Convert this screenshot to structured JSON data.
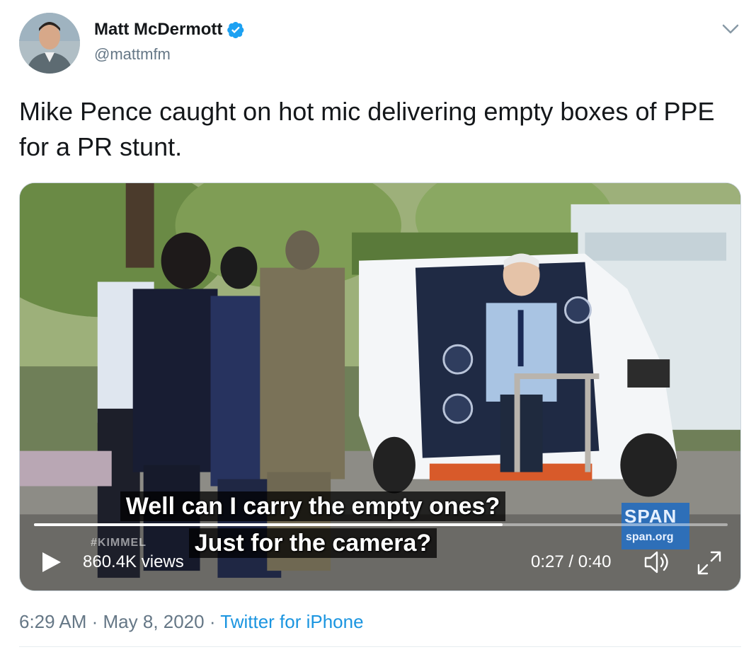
{
  "author": {
    "display_name": "Matt McDermott",
    "handle": "@mattmfm",
    "verified": true,
    "avatar_icon": "profile-photo"
  },
  "tweet": {
    "text": "Mike Pence caught on hot mic delivering empty boxes of PPE for a PR stunt."
  },
  "video": {
    "caption_line1": "Well can I carry the empty ones?",
    "caption_line2": "Just for the camera?",
    "watermark": "#KIMMEL",
    "network_logo_big": "SPAN",
    "network_logo_small": "span.org",
    "views": "860.4K views",
    "time": "0:27 / 0:40",
    "progress": 0.675,
    "icons": {
      "play": "play-icon",
      "volume": "volume-icon",
      "expand": "expand-icon"
    }
  },
  "footer": {
    "time": "6:29 AM",
    "separator": " · ",
    "date": "May 8, 2020",
    "source": "Twitter for iPhone"
  },
  "colors": {
    "link": "#1b95e0",
    "verified": "#1da1f2",
    "secondary_text": "#657786"
  }
}
